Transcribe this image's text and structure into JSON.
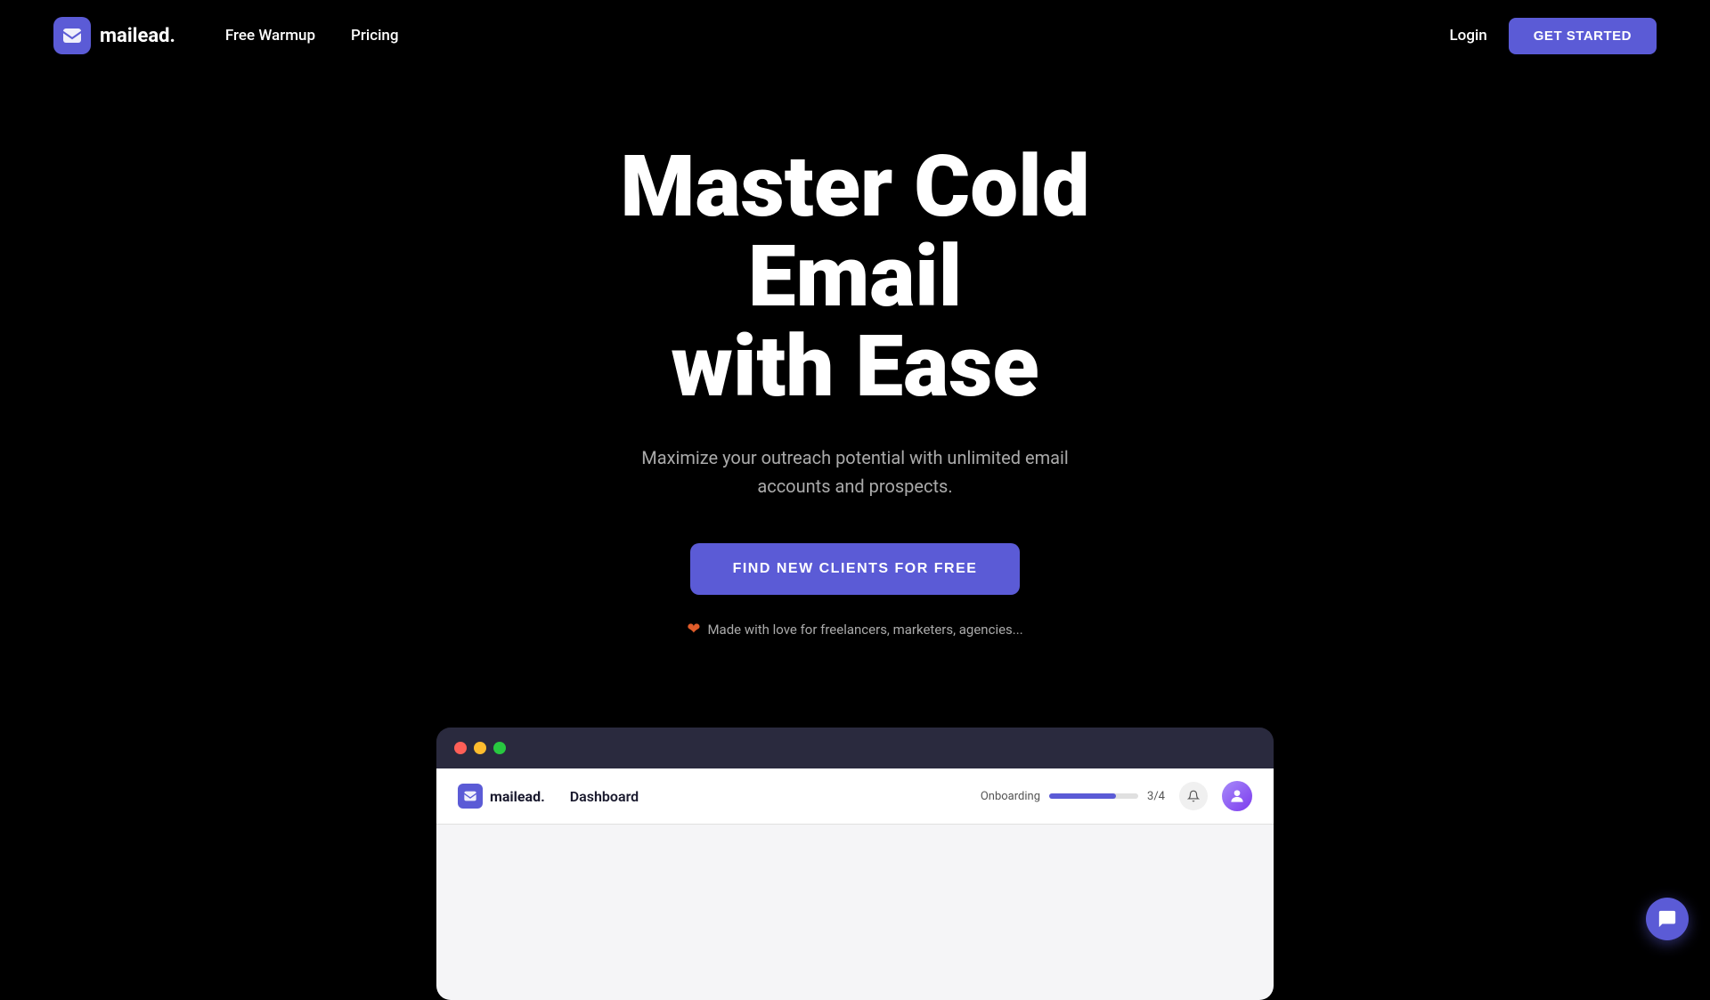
{
  "brand": {
    "name": "mailead.",
    "logo_alt": "mailead logo"
  },
  "nav": {
    "links": [
      {
        "label": "Free Warmup",
        "id": "free-warmup"
      },
      {
        "label": "Pricing",
        "id": "pricing"
      }
    ],
    "login_label": "Login",
    "get_started_label": "GET STARTED"
  },
  "hero": {
    "title_line1": "Master Cold",
    "title_line2": "Email",
    "title_line3": "with Ease",
    "subtitle": "Maximize your outreach potential with unlimited email accounts and prospects.",
    "cta_label": "FIND NEW CLIENTS FOR FREE",
    "love_text": "Made with love for freelancers, marketers, agencies..."
  },
  "dashboard": {
    "tab_label": "Dashboard",
    "onboarding_label": "Onboarding",
    "onboarding_progress": "3/4",
    "onboarding_percent": 75
  },
  "colors": {
    "accent": "#5b5bd6",
    "heart": "#e05c2a",
    "bg": "#000000",
    "nav_bg": "#000000"
  }
}
